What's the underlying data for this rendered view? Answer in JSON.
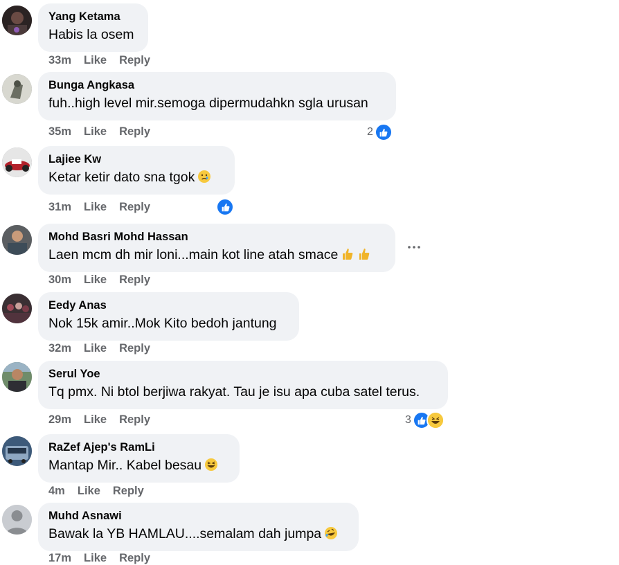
{
  "comments": [
    {
      "name": "Yang Ketama",
      "text": "Habis la osem",
      "time": "33m",
      "like": "Like",
      "reply": "Reply"
    },
    {
      "name": "Bunga Angkasa",
      "text": "fuh..high level mir.semoga dipermudahkn sgla urusan",
      "time": "35m",
      "like": "Like",
      "reply": "Reply",
      "reaction_count": "2"
    },
    {
      "name": "Lajiee Kw",
      "text": "Ketar ketir dato sna tgok",
      "time": "31m",
      "like": "Like",
      "reply": "Reply"
    },
    {
      "name": "Mohd Basri Mohd Hassan",
      "text": "Laen mcm dh mir loni...main kot line atah smace",
      "time": "30m",
      "like": "Like",
      "reply": "Reply"
    },
    {
      "name": "Eedy Anas",
      "text": "Nok 15k amir..Mok Kito bedoh jantung",
      "time": "32m",
      "like": "Like",
      "reply": "Reply"
    },
    {
      "name": "Serul Yoe",
      "text": "Tq pmx. Ni btol berjiwa rakyat. Tau je isu apa cuba satel terus.",
      "time": "29m",
      "like": "Like",
      "reply": "Reply",
      "reaction_count": "3"
    },
    {
      "name": "RaZef Ajep's RamLi",
      "text": "Mantap Mir.. Kabel besau",
      "time": "4m",
      "like": "Like",
      "reply": "Reply"
    },
    {
      "name": "Muhd Asnawi",
      "text": "Bawak la YB HAMLAU....semalam dah jumpa",
      "time": "17m",
      "like": "Like",
      "reply": "Reply"
    }
  ],
  "icons": {
    "like": "like-reaction-icon",
    "haha": "haha-reaction-icon",
    "more": "more-options-icon"
  },
  "colors": {
    "bubble": "#f0f2f5",
    "meta": "#65676b",
    "like_blue": "#1877f2"
  }
}
